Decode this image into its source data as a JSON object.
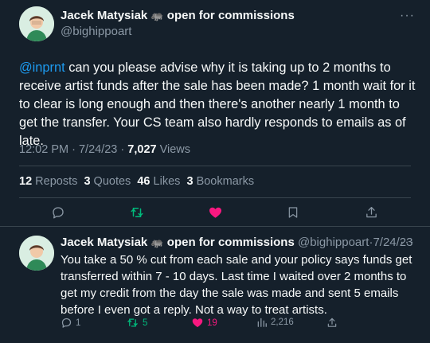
{
  "tweet": {
    "author_name": "Jacek Matysiak",
    "name_emoji": "🦛",
    "status_text": "open for commissions",
    "handle": "@bighippoart",
    "more_label": "···",
    "mention": "@inprnt",
    "text": " can you please advise why it is taking up to 2 months to receive artist funds after the sale has been made? 1 month wait for it to clear is long enough and then there's another nearly 1 month to get the transfer. Your CS team also hardly responds to emails as of late.",
    "time": "12:02 PM",
    "date": "7/24/23",
    "views_count": "7,027",
    "views_label": "Views",
    "separator": "·",
    "reposts_count": "12",
    "reposts_label": "Reposts",
    "quotes_count": "3",
    "quotes_label": "Quotes",
    "likes_count": "46",
    "likes_label": "Likes",
    "bookmarks_count": "3",
    "bookmarks_label": "Bookmarks"
  },
  "reply": {
    "author_name": "Jacek Matysiak",
    "name_emoji": "🦛",
    "status_text": "open for commissions",
    "handle": "@bighippoart",
    "separator": "·",
    "date": "7/24/23",
    "more_label": "···",
    "text": "You take a 50 % cut from each sale and your policy says funds get transferred within 7 - 10 days. Last time I waited over 2 months to get my credit from the day the sale was made and sent 5 emails before I even got a reply. Not a way to treat artists.",
    "replies_count": "1",
    "reposts_count": "5",
    "likes_count": "19",
    "views_count": "2,216"
  },
  "colors": {
    "background": "#15202b",
    "text": "#f7f9f9",
    "secondary": "#8b98a5",
    "link": "#1d9bf0",
    "repost_active": "#00ba7c",
    "like_active": "#f91880"
  },
  "icons": [
    "reply-icon",
    "repost-icon",
    "like-icon",
    "bookmark-icon",
    "share-icon",
    "views-icon",
    "more-icon",
    "hippo-emoji"
  ]
}
